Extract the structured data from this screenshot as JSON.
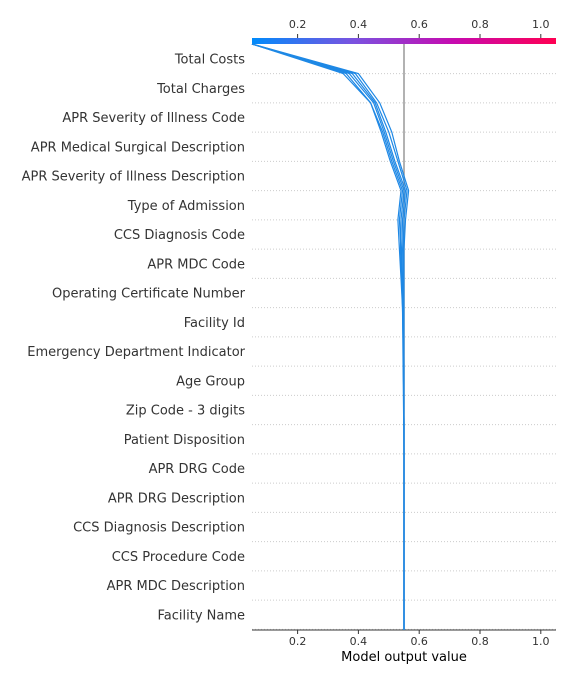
{
  "chart_data": {
    "type": "line",
    "title": "",
    "xlabel": "Model output value",
    "ylabel": "",
    "xlim": [
      0.05,
      1.05
    ],
    "x_ticks": [
      0.2,
      0.4,
      0.6,
      0.8,
      1.0
    ],
    "tick_labels": [
      "0.2",
      "0.4",
      "0.6",
      "0.8",
      "1.0"
    ],
    "base_value": 0.55,
    "colorbar": {
      "range": [
        0.05,
        1.05
      ],
      "colors": [
        "#008bfb",
        "#7a52e0",
        "#c70aaf",
        "#ff0052"
      ]
    },
    "line_color": "#1e88e5",
    "grid": "dotted horizontal",
    "features": [
      "Total Costs",
      "Total Charges",
      "APR Severity of Illness Code",
      "APR Medical Surgical Description",
      "APR Severity of Illness Description",
      "Type of Admission",
      "CCS Diagnosis Code",
      "APR MDC Code",
      "Operating Certificate Number",
      "Facility Id",
      "Emergency Department Indicator",
      "Age Group",
      "Zip Code - 3 digits",
      "Patient Disposition",
      "APR DRG Code",
      "APR DRG Description",
      "CCS Diagnosis Description",
      "CCS Procedure Code",
      "APR MDC Description",
      "Facility Name"
    ],
    "series": [
      {
        "values": [
          0.05,
          0.36,
          0.44,
          0.48,
          0.51,
          0.545,
          0.535,
          0.54,
          0.543,
          0.546,
          0.547,
          0.548,
          0.549,
          0.55,
          0.55,
          0.55,
          0.55,
          0.55,
          0.55,
          0.55,
          0.55
        ]
      },
      {
        "values": [
          0.05,
          0.37,
          0.45,
          0.485,
          0.515,
          0.55,
          0.54,
          0.538,
          0.542,
          0.545,
          0.547,
          0.548,
          0.549,
          0.55,
          0.55,
          0.55,
          0.55,
          0.55,
          0.55,
          0.55,
          0.55
        ]
      },
      {
        "values": [
          0.05,
          0.38,
          0.455,
          0.49,
          0.52,
          0.555,
          0.545,
          0.543,
          0.545,
          0.547,
          0.548,
          0.549,
          0.549,
          0.55,
          0.55,
          0.55,
          0.55,
          0.55,
          0.55,
          0.55,
          0.55
        ]
      },
      {
        "values": [
          0.05,
          0.39,
          0.46,
          0.5,
          0.53,
          0.56,
          0.55,
          0.547,
          0.548,
          0.549,
          0.549,
          0.55,
          0.55,
          0.55,
          0.55,
          0.55,
          0.55,
          0.55,
          0.55,
          0.55,
          0.55
        ]
      },
      {
        "values": [
          0.05,
          0.4,
          0.47,
          0.51,
          0.535,
          0.565,
          0.555,
          0.55,
          0.55,
          0.55,
          0.55,
          0.55,
          0.55,
          0.55,
          0.55,
          0.55,
          0.55,
          0.55,
          0.55,
          0.55,
          0.55
        ]
      },
      {
        "values": [
          0.05,
          0.35,
          0.44,
          0.475,
          0.505,
          0.54,
          0.53,
          0.535,
          0.54,
          0.545,
          0.546,
          0.547,
          0.548,
          0.549,
          0.55,
          0.55,
          0.55,
          0.55,
          0.55,
          0.55,
          0.55
        ]
      }
    ]
  }
}
